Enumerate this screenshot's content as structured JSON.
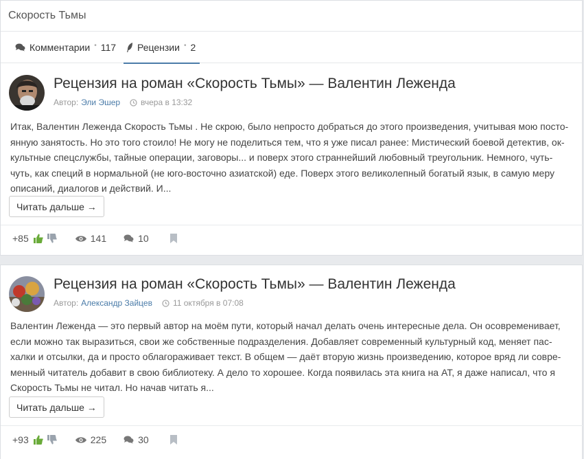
{
  "header": {
    "title": "Скорость Тьмы"
  },
  "tabs": [
    {
      "label": "Комментарии",
      "count": "117",
      "icon": "comments-icon"
    },
    {
      "label": "Рецензии",
      "count": "2",
      "icon": "feather-icon",
      "active": true
    }
  ],
  "reviews": [
    {
      "title": "Рецензия на роман «Скорость Тьмы» — Валентин Лежендa",
      "author_prefix": "Автор:",
      "author": "Эли Эшер",
      "date": "вчера в 13:32",
      "excerpt": "Итак, Валентин Лежендa Скорость Тьмы . Не скрою, было непросто добраться до этого произведения, учитывая мою посто-янную занятость. Но это того стоило! Не могу не поделиться тем, что я уже писал ранее: Мистический боевой детектив, ок-культные спецслужбы, тайные операции, заговоры... и поверх этого страннейший любовный треугольник. Немного, чуть-чуть, как специй в нормальной (не юго-восточно азиатской) еде. Поверх этого великолепный богатый язык, в самую меру описаний, диалогов и действий. И...",
      "read_more": "Читать дальше →",
      "rating": "+85",
      "views": "141",
      "comments": "10"
    },
    {
      "title": "Рецензия на роман «Скорость Тьмы» — Валентин Лежендa",
      "author_prefix": "Автор:",
      "author": "Александр Зайцев",
      "date": "11 октября в 07:08",
      "excerpt": "Валентин Лежендa — это первый автор на моём пути, который начал делать очень интересные дела. Он осовременивает, если можно так выразиться, свои же собственные подразделения. Добавляет современный культурный код, меняет пас-халки и отсылки, да и просто облагораживает текст. В общем — даёт вторую жизнь произведению, которое вряд ли совре-менный читатель добавит в свою библиотеку. А дело то хорошее. Когда появилась эта книга на АТ, я даже написал, что я Скорость Тьмы не читал. Но начав читать я...",
      "read_more": "Читать дальше →",
      "rating": "+93",
      "views": "225",
      "comments": "30"
    }
  ],
  "colors": {
    "accent": "#4a7ba8",
    "like": "#6aab3a",
    "muted": "#9aa3ad"
  }
}
